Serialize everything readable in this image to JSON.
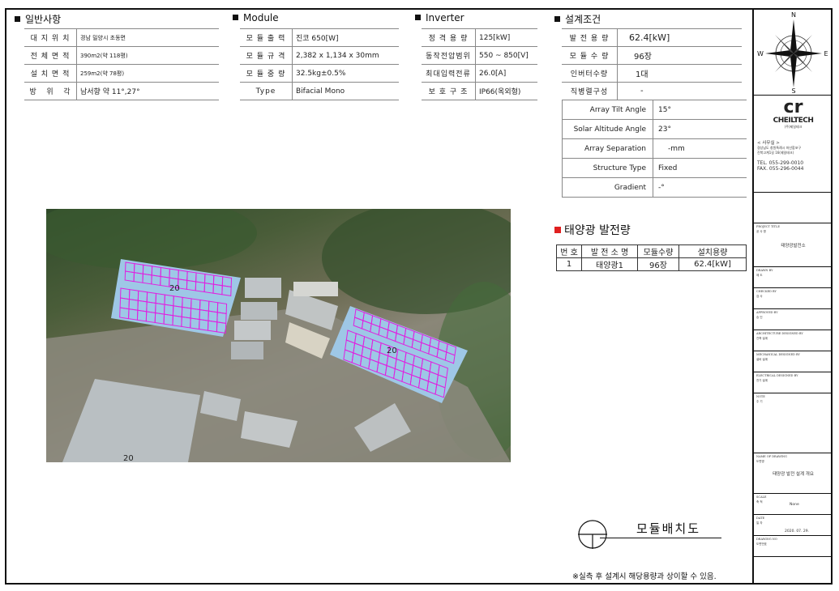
{
  "general": {
    "title": "일반사항",
    "rows": [
      {
        "label": "대 지 위 치",
        "value": "경남 밀양시 초동면"
      },
      {
        "label": "전 체 면 적",
        "value": "390m2(약 118평)"
      },
      {
        "label": "설 치 면 적",
        "value": "259m2(약 78평)"
      },
      {
        "label": "방   위   각",
        "value": "남서향 약 11°,27°"
      }
    ]
  },
  "module": {
    "title": "Module",
    "rows": [
      {
        "label": "모 듈 출 력",
        "value": "진코 650[W]"
      },
      {
        "label": "모 듈 규 격",
        "value": "2,382 x 1,134 x 30mm"
      },
      {
        "label": "모 듈 중 량",
        "value": "32.5kg±0.5%"
      },
      {
        "label": "Type",
        "value": "Bifacial Mono"
      }
    ]
  },
  "inverter": {
    "title": "Inverter",
    "rows": [
      {
        "label": "정 격 용 량",
        "value": "125[kW]"
      },
      {
        "label": "동작전압범위",
        "value": "550 ~ 850[V]"
      },
      {
        "label": "최대입력전류",
        "value": "26.0[A]"
      },
      {
        "label": "보 호 구 조",
        "value": "IP66(옥외형)"
      }
    ]
  },
  "design": {
    "title": "설계조건",
    "rows": [
      {
        "label": "발 전 용 량",
        "value": "62.4[kW]"
      },
      {
        "label": "모 듈 수 량",
        "value": "96장"
      },
      {
        "label": "인버터수량",
        "value": "1대"
      },
      {
        "label": "직병렬구성",
        "value": "-"
      }
    ],
    "rows2": [
      {
        "label": "Array Tilt Angle",
        "value": "15°"
      },
      {
        "label": "Solar Altitude Angle",
        "value": "23°"
      },
      {
        "label": "Array Separation",
        "value": "-mm"
      },
      {
        "label": "Structure Type",
        "value": "Fixed"
      },
      {
        "label": "Gradient",
        "value": "-°"
      }
    ]
  },
  "map": {
    "labels": [
      "20",
      "20",
      "20"
    ],
    "colors": {
      "panel": "#e020e0",
      "roof": "#9ec7e6"
    }
  },
  "generation": {
    "title": "태양광 발전량",
    "headers": [
      "번 호",
      "발 전 소 명",
      "모듈수량",
      "설치용량"
    ],
    "rows": [
      [
        "1",
        "태양광1",
        "96장",
        "62.4[kW]"
      ]
    ]
  },
  "drawing": {
    "layout_title": "모듈배치도",
    "footnote": "※실측 후 설계시 해당용량과 상이할 수 있음."
  },
  "titleblock": {
    "compass": {
      "n": "N",
      "s": "S",
      "e": "E",
      "w": "W"
    },
    "company": {
      "logo": "cr",
      "name": "CHEILTECH",
      "sub": "(주)제일테크"
    },
    "office": {
      "label": "< 사무실 >",
      "address": [
        "경상남도 창원특례시 마산합포구",
        "진북고계1길 16(제일테크)"
      ],
      "tel": "TEL. 055-299-0010",
      "fax": "FAX. 055-296-0044"
    },
    "project": {
      "label": "PROJECT TITLE",
      "label_ko": "공 사 명",
      "value": "태양광발전소"
    },
    "drawn": {
      "label": "DRAWN BY",
      "label_ko": "제 도"
    },
    "checked": {
      "label": "CHECKED BY",
      "label_ko": "검 사"
    },
    "approved": {
      "label": "APPROVED BY",
      "label_ko": "승 인"
    },
    "arch": {
      "label": "ARCHITECTURE DESIGNED BY",
      "label_ko": "건축 설계"
    },
    "mech": {
      "label": "MECHANICAL DESIGNED BY",
      "label_ko": "설비 설계"
    },
    "elec": {
      "label": "ELECTRICAL DESIGNED BY",
      "label_ko": "전기 설계"
    },
    "note": {
      "label": "NOTE",
      "label_ko": "주 기"
    },
    "drawing_name": {
      "label": "NAME OF DRAWING",
      "label_ko": "도면명",
      "value": "태양광 발전 설계 개요"
    },
    "scale": {
      "label": "SCALE",
      "label_ko": "축 척",
      "value": "None"
    },
    "date": {
      "label": "DATE",
      "label_ko": "일 자",
      "value": "2020. 07. 29."
    },
    "drawing_no": {
      "label": "DRAWING NO",
      "label_ko": "도면번호"
    }
  }
}
